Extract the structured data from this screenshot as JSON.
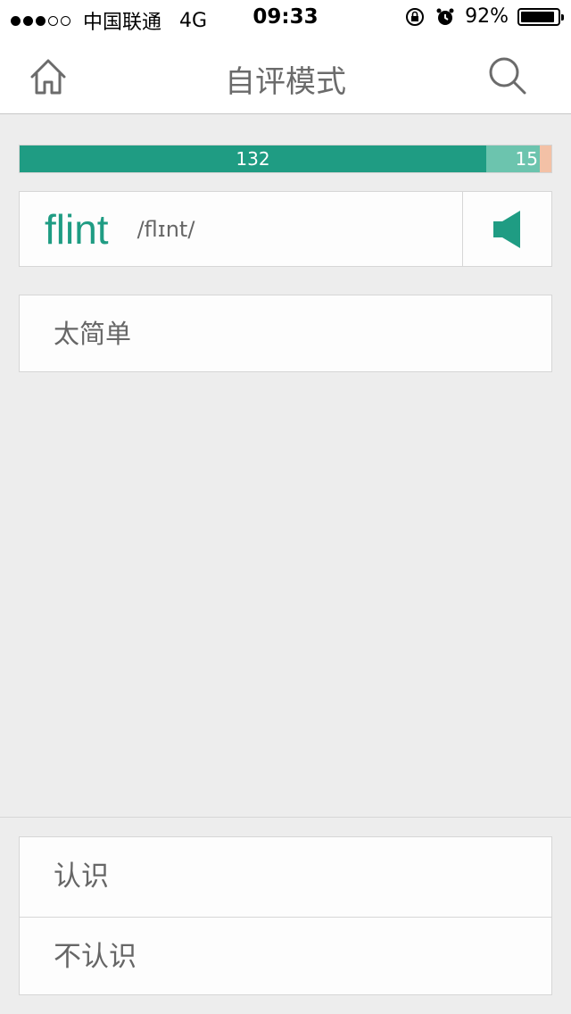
{
  "status_bar": {
    "carrier": "中国联通",
    "network": "4G",
    "time": "09:33",
    "battery": "92%",
    "battery_level": 0.92,
    "signal_bars_filled": 3,
    "signal_bars_total": 5
  },
  "nav": {
    "title": "自评模式",
    "home_icon": "home-icon",
    "search_icon": "search-icon"
  },
  "progress": {
    "known_count": "132",
    "unsure_count": "15",
    "unknown_count": "",
    "colors": {
      "known": "#1f9c83",
      "unsure": "#6cc4ae",
      "unknown": "#f3c1a6"
    }
  },
  "word": {
    "text": "flint",
    "phonetic": "/flɪnt/",
    "speaker_icon": "speaker-icon",
    "accent_color": "#1f9c83"
  },
  "definition_hint": "太简单",
  "actions": {
    "know_label": "认识",
    "dont_know_label": "不认识"
  }
}
